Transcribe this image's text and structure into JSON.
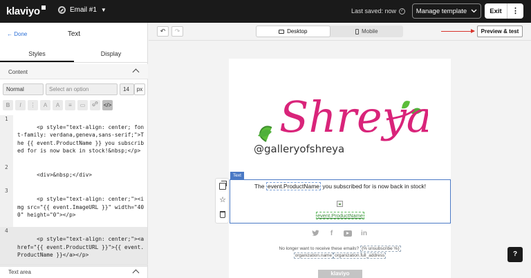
{
  "topbar": {
    "logo": "klaviyo",
    "email_title": "Email #1",
    "saved_text": "Last saved: now",
    "manage_label": "Manage template",
    "exit_label": "Exit"
  },
  "left_panel": {
    "done_label": "Done",
    "title": "Text",
    "tabs": [
      "Styles",
      "Display"
    ],
    "content_section": "Content",
    "style_select": "Normal",
    "option_placeholder": "Select an option",
    "font_size": "14",
    "font_unit": "px",
    "toolbar": [
      "B",
      "I",
      "⋮",
      "A",
      "A",
      "≡",
      "▭",
      "🔗",
      "</>"
    ],
    "textarea_section": "Text area",
    "code_lines": [
      {
        "num": "1",
        "text": "<p style=\"text-align: center; font-family: verdana,geneva,sans-serif;\">The {{ event.ProductName }} you subscribed for is now back in stock!&nbsp;</p>"
      },
      {
        "num": "2",
        "text": "<div>&nbsp;</div>"
      },
      {
        "num": "3",
        "text": "<p style=\"text-align: center;\"><img src=\"{{ event.ImageURL }}\" width=\"400\" height=\"0\"></p>"
      },
      {
        "num": "4",
        "text": "<p style=\"text-align: center;\"><a href=\"{{ event.ProductURL }}\">{{ event.ProductName }}</a></p>"
      }
    ]
  },
  "canvas": {
    "desktop_label": "Desktop",
    "mobile_label": "Mobile",
    "preview_label": "Preview & test",
    "brand_text": "Shreya",
    "brand_sub": "@galleryofshreya",
    "block_tag": "Text",
    "line_before": "The ",
    "line_var": "event.ProductName",
    "line_after": " you subscribed for is now back in stock!",
    "link_var": "event.ProductName",
    "footer_text": "No longer want to receive these emails? ",
    "footer_unsub": "{% unsubscribe %}",
    "footer_org1": "organization.name",
    "footer_org2": "organization.full_address",
    "badge": "klaviyo",
    "help": "?"
  }
}
